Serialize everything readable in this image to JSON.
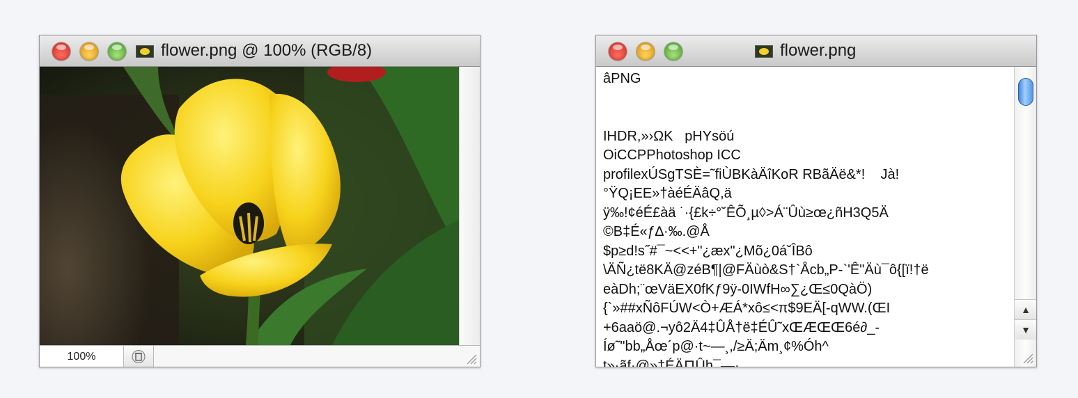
{
  "windows": {
    "image": {
      "title": "flower.png @ 100% (RGB/8)",
      "zoom": "100%",
      "icon": "image-file-icon"
    },
    "text": {
      "title": "flower.png",
      "icon": "image-file-icon",
      "lines": [
        "âPNG",
        "",
        "",
        "IHDR,»›ΩK   pHYsöú",
        "OiCCPPhotoshop ICC",
        "profilexÚSgTSÈ=˜fiÙBKàÄîKoR RBãÄë&*!    Jà!",
        "°ŸQ¡EE»†àéÉÄâQ,ä",
        "ÿ‰!¢éÉ£àä ˙·{£k÷°˘ÊÕ¸µ◊>Á¨Ûù≥œ¿ñH3Q5Ä",
        "©B‡É«ƒ∆·‰.@Å",
        "$p≥d!s˝#¯~<<+\"¿æx\"¿Mõ¿0á˘ÎBô",
        "\\ÄÑ¿të8KÄ@zéB¶|@FÄùò&S†`Åcb„P-`'Ê\"Äù¯ô{[ï!†ë",
        "eàDh;¨œVäEX0fKƒ9ÿ-0IWfH∞∑¿Œ≤0QàÖ)",
        "{`»##xÑôFÚW<Ò+ÆÁ*xô≤<π$9EÄ[-qWW.(ŒI",
        "+6aaö@.¬yô2Ä4‡ÛÅ†ë‡ÉÛ˜xŒÆŒŒ6é∂_-",
        "Íø˜\"bb„Åœ´p@·t~—¸,/≥Ä;Äm¸¢%Óh^",
        "t»·ãf·@»†ÉÄ∏Ûh¯—·"
      ]
    }
  }
}
